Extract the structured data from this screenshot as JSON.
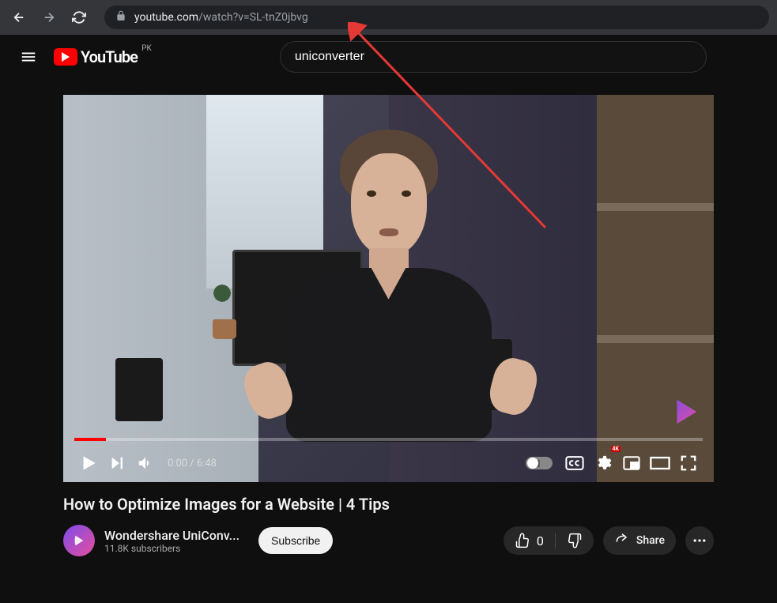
{
  "browser": {
    "url_domain": "youtube.com",
    "url_path": "/watch?v=SL-tnZ0jbvg"
  },
  "header": {
    "logo_text": "YouTube",
    "region": "PK",
    "search_value": "uniconverter"
  },
  "player": {
    "current_time": "0:00",
    "duration": "6:48",
    "quality_badge": "4K"
  },
  "video": {
    "title": "How to Optimize Images for a Website | 4 Tips"
  },
  "channel": {
    "name": "Wondershare UniConv...",
    "subscribers": "11.8K subscribers",
    "subscribe_label": "Subscribe"
  },
  "actions": {
    "like_count": "0",
    "share_label": "Share"
  }
}
